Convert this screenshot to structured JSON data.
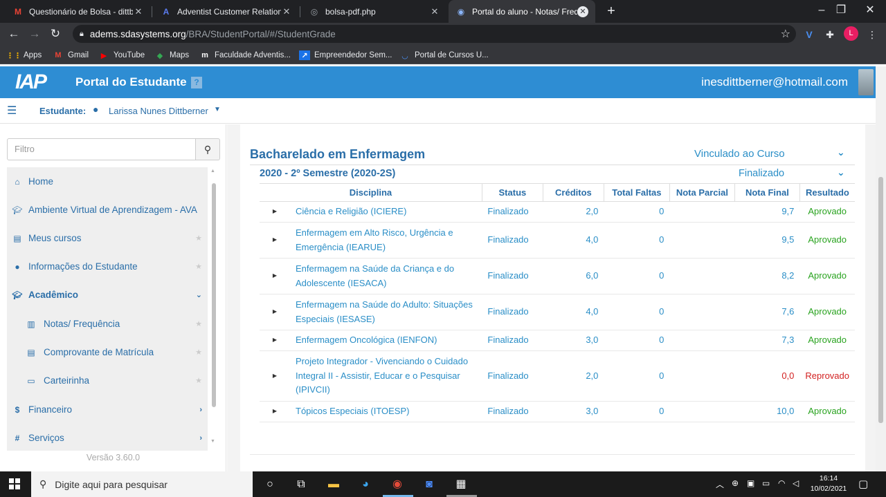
{
  "browser": {
    "tabs": [
      {
        "title": "Questionário de Bolsa - dittberner",
        "favicon": "gmail-icon",
        "active": false
      },
      {
        "title": "Adventist Customer Relationship",
        "favicon": "adventist-icon",
        "active": false
      },
      {
        "title": "bolsa-pdf.php",
        "favicon": "globe-icon",
        "active": false
      },
      {
        "title": "Portal do aluno - Notas/ Frequência",
        "favicon": "portal-icon",
        "active": true
      }
    ],
    "new_tab": "+",
    "url_host": "adems.sdasystems.org",
    "url_path": "/BRA/StudentPortal/#/StudentGrade",
    "profile_initial": "L",
    "bookmarks": [
      {
        "label": "Apps",
        "icon": "apps-grid-icon"
      },
      {
        "label": "Gmail",
        "icon": "gmail-icon"
      },
      {
        "label": "YouTube",
        "icon": "youtube-icon"
      },
      {
        "label": "Maps",
        "icon": "maps-icon"
      },
      {
        "label": "Faculdade Adventis...",
        "icon": "faculdade-icon"
      },
      {
        "label": "Empreendedor Sem...",
        "icon": "empreendedor-icon"
      },
      {
        "label": "Portal de Cursos U...",
        "icon": "portal-cursos-icon"
      }
    ]
  },
  "header": {
    "logo": "IAP",
    "portal_title": "Portal do Estudante",
    "user_email": "inesdittberner@hotmail.com",
    "student_label": "Estudante:",
    "student_name": "Larissa Nunes Dittberner"
  },
  "sidebar": {
    "filter_placeholder": "Filtro",
    "items": [
      {
        "label": "Home",
        "icon": "home-icon"
      },
      {
        "label": "Ambiente Virtual de Aprendizagem - AVA",
        "icon": "graduation-cap-icon"
      },
      {
        "label": "Meus cursos",
        "icon": "document-icon"
      },
      {
        "label": "Informações do Estudante",
        "icon": "user-icon"
      },
      {
        "label": "Acadêmico",
        "icon": "graduation-cap-icon"
      },
      {
        "label": "Notas/ Frequência",
        "icon": "bar-chart-icon"
      },
      {
        "label": "Comprovante de Matrícula",
        "icon": "document-icon"
      },
      {
        "label": "Carteirinha",
        "icon": "card-icon"
      },
      {
        "label": "Financeiro",
        "icon": "dollar-icon"
      },
      {
        "label": "Serviços",
        "icon": "hash-icon"
      }
    ],
    "version": "Versão 3.60.0"
  },
  "main": {
    "course_title": "Bacharelado em Enfermagem",
    "course_status": "Vinculado ao Curso",
    "semester_title": "2020 - 2º Semestre (2020-2S)",
    "semester_status": "Finalizado",
    "columns": [
      "Disciplina",
      "Status",
      "Créditos",
      "Total Faltas",
      "Nota Parcial",
      "Nota Final",
      "Resultado"
    ],
    "rows": [
      {
        "disciplina": "Ciência e Religião (ICIERE)",
        "status": "Finalizado",
        "creditos": "2,0",
        "faltas": "0",
        "parcial": "",
        "final": "9,7",
        "resultado": "Aprovado"
      },
      {
        "disciplina": "Enfermagem em Alto Risco, Urgência e Emergência (IEARUE)",
        "status": "Finalizado",
        "creditos": "4,0",
        "faltas": "0",
        "parcial": "",
        "final": "9,5",
        "resultado": "Aprovado"
      },
      {
        "disciplina": "Enfermagem na Saúde da Criança e do Adolescente (IESACA)",
        "status": "Finalizado",
        "creditos": "6,0",
        "faltas": "0",
        "parcial": "",
        "final": "8,2",
        "resultado": "Aprovado"
      },
      {
        "disciplina": "Enfermagem na Saúde do Adulto: Situações Especiais (IESASE)",
        "status": "Finalizado",
        "creditos": "4,0",
        "faltas": "0",
        "parcial": "",
        "final": "7,6",
        "resultado": "Aprovado"
      },
      {
        "disciplina": "Enfermagem Oncológica (IENFON)",
        "status": "Finalizado",
        "creditos": "3,0",
        "faltas": "0",
        "parcial": "",
        "final": "7,3",
        "resultado": "Aprovado"
      },
      {
        "disciplina": "Projeto Integrador - Vivenciando o Cuidado Integral II - Assistir, Educar e o Pesquisar (IPIVCII)",
        "status": "Finalizado",
        "creditos": "2,0",
        "faltas": "0",
        "parcial": "",
        "final": "0,0",
        "resultado": "Reprovado"
      },
      {
        "disciplina": "Tópicos Especiais (ITOESP)",
        "status": "Finalizado",
        "creditos": "3,0",
        "faltas": "0",
        "parcial": "",
        "final": "10,0",
        "resultado": "Aprovado"
      }
    ]
  },
  "taskbar": {
    "search_placeholder": "Digite aqui para pesquisar",
    "time": "16:14",
    "date": "10/02/2021"
  },
  "colors": {
    "header_blue": "#2e8dd3",
    "link_blue": "#2a6ea8",
    "approved_green": "#29a31f",
    "failed_red": "#d21f1f"
  }
}
